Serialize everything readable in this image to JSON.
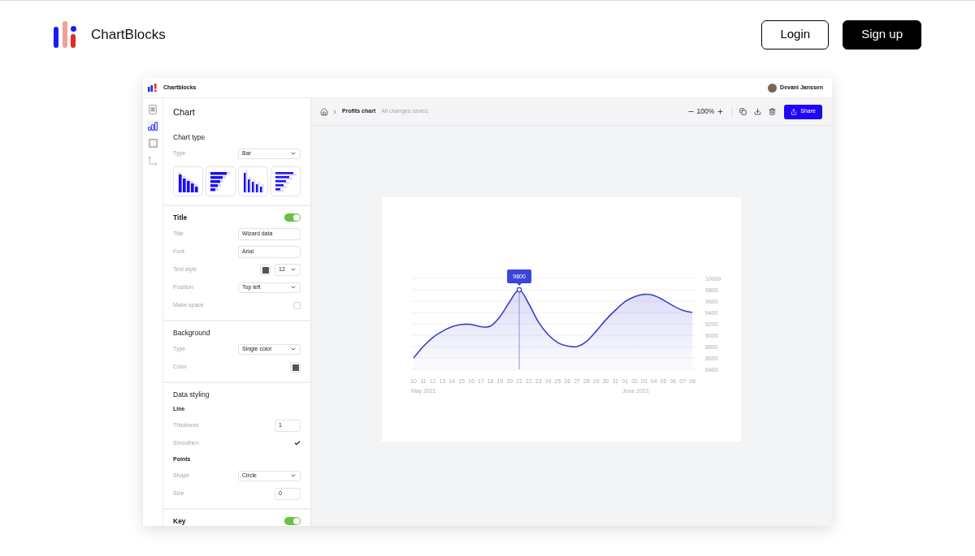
{
  "site_header": {
    "brand": "ChartBlocks",
    "buttons": [
      {
        "label": "Login",
        "kind": "outline"
      },
      {
        "label": "Sign up",
        "kind": "solid"
      }
    ]
  },
  "app": {
    "top_bar": {
      "brand": "Chartblocks",
      "user": "Devani Janssen"
    },
    "rail": [
      {
        "selected": false
      },
      {
        "selected": true
      },
      {
        "selected": false
      },
      {
        "selected": false
      }
    ],
    "panel": {
      "title": "Chart",
      "sections": [
        {
          "heading": "Chart type",
          "rows": [
            {
              "kind": "select",
              "label": "Type",
              "value": "Bar"
            },
            {
              "kind": "chart_type_picker"
            }
          ]
        },
        {
          "heading": "Title",
          "toggle": {
            "on": true
          },
          "rows": [
            {
              "kind": "input",
              "label": "Title",
              "value": "Wizard data"
            },
            {
              "kind": "input",
              "label": "Font",
              "value": "Arial"
            },
            {
              "kind": "text_style",
              "label": "Text style",
              "color": "#555555",
              "value": "12"
            },
            {
              "kind": "select",
              "label": "Position",
              "value": "Top left"
            },
            {
              "kind": "checkbox",
              "label": "Make space",
              "checked": false
            }
          ]
        },
        {
          "heading": "Background",
          "rows": [
            {
              "kind": "select",
              "label": "Type",
              "value": "Single color"
            },
            {
              "kind": "swatch",
              "label": "Color",
              "color": "#555555"
            }
          ]
        },
        {
          "heading": "Data styling",
          "rows": [
            {
              "kind": "subheading",
              "label": "Line"
            },
            {
              "kind": "number",
              "label": "Thickness",
              "value": "1"
            },
            {
              "kind": "check",
              "label": "Smoothen",
              "checked": true
            },
            {
              "kind": "subheading",
              "label": "Points"
            },
            {
              "kind": "select",
              "label": "Shape",
              "value": "Circle"
            },
            {
              "kind": "number",
              "label": "Size",
              "value": "0"
            }
          ]
        },
        {
          "heading": "Key",
          "toggle": {
            "on": true
          }
        }
      ]
    },
    "toolbar": {
      "breadcrumb": "Profits chart",
      "status": "All changes saved.",
      "zoom": "100%",
      "share": "Share"
    },
    "chart": {
      "chart_data": {
        "type": "area",
        "categories": [
          "10",
          "11",
          "12",
          "13",
          "14",
          "15",
          "16",
          "17",
          "18",
          "19",
          "20",
          "21",
          "22",
          "23",
          "24",
          "25",
          "26",
          "27",
          "28",
          "29",
          "30",
          "31",
          "01",
          "02",
          "03",
          "04",
          "05",
          "06",
          "07",
          "08"
        ],
        "values": [
          8600,
          8800,
          8960,
          9070,
          9150,
          9190,
          9190,
          9150,
          9160,
          9330,
          9590,
          9800,
          9550,
          9230,
          9010,
          8870,
          8810,
          8800,
          8890,
          9070,
          9270,
          9440,
          9590,
          9680,
          9720,
          9700,
          9620,
          9520,
          9440,
          9400
        ],
        "ylim": [
          8400,
          10000
        ],
        "yticks": [
          8400,
          8600,
          8800,
          9000,
          9200,
          9400,
          9600,
          9800,
          10000
        ],
        "grid": true,
        "ref_lines": [
          {
            "axis": "x",
            "value": "21"
          }
        ],
        "annotations": [
          {
            "x": "21",
            "y": 9800,
            "text": "9800"
          },
          "May 2021",
          "June 2021"
        ]
      }
    }
  }
}
